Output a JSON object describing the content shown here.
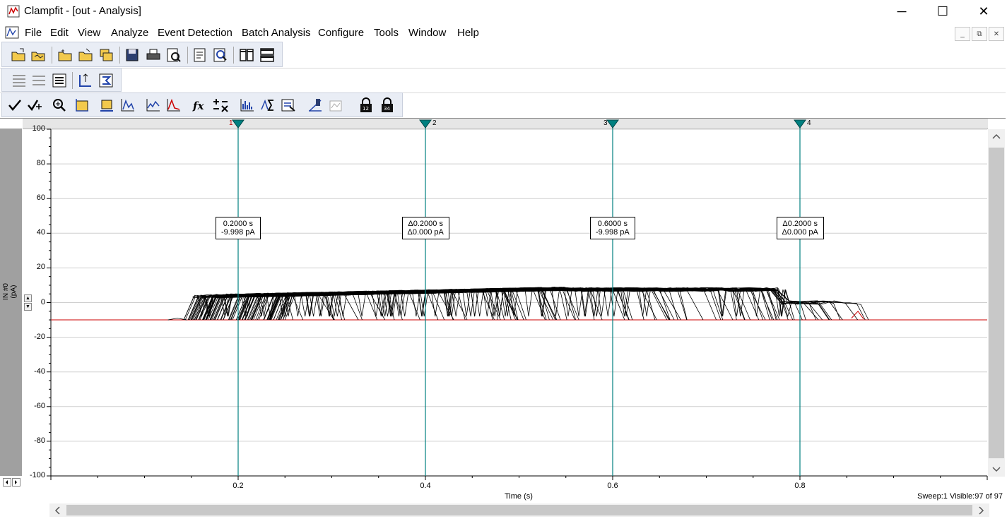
{
  "window": {
    "title": "Clampfit - [out - Analysis]",
    "minimize_glyph": "─",
    "maximize_glyph": "☐",
    "close_glyph": "✕"
  },
  "menu": {
    "items": [
      "File",
      "Edit",
      "View",
      "Analyze",
      "Event Detection",
      "Batch Analysis",
      "Configure",
      "Tools",
      "Window",
      "Help"
    ],
    "mdi_min": "_",
    "mdi_restore": "⧉",
    "mdi_close": "✕"
  },
  "plot": {
    "y_axis_label_line1": "IN #0",
    "y_axis_label_line2": "(pA)",
    "x_axis_label": "Time (s)",
    "y_ticks": [
      "100",
      "80",
      "60",
      "40",
      "20",
      "0",
      "-20",
      "-40",
      "-60",
      "-80",
      "-100"
    ],
    "x_ticks": [
      "0.2",
      "0.4",
      "0.6",
      "0.8"
    ],
    "status": "Sweep:1 Visible:97 of 97"
  },
  "cursors": [
    {
      "num": "1",
      "line1": "0.2000 s",
      "line2": "-9.998 pA"
    },
    {
      "num": "2",
      "line1": "Δ0.2000 s",
      "line2": "Δ0.000 pA"
    },
    {
      "num": "3",
      "line1": "0.6000 s",
      "line2": "-9.998 pA"
    },
    {
      "num": "4",
      "line1": "Δ0.2000 s",
      "line2": "Δ0.000 pA"
    }
  ],
  "chart_data": {
    "type": "line",
    "xlabel": "Time (s)",
    "ylabel": "IN #0 (pA)",
    "xlim": [
      0,
      1.0
    ],
    "ylim": [
      -100,
      100
    ],
    "x_ticks": [
      0.2,
      0.4,
      0.6,
      0.8
    ],
    "y_ticks": [
      100,
      80,
      60,
      40,
      20,
      0,
      -20,
      -40,
      -60,
      -80,
      -100
    ],
    "cursor_times_s": [
      0.2,
      0.4,
      0.6,
      0.8
    ],
    "baseline_pA": -10,
    "sweep_count": 97,
    "series_summary": {
      "open_level_pA_start": 4,
      "open_level_pA_mid": 8,
      "open_level_pA_end": 0,
      "onset_range_s": [
        0.15,
        0.26
      ],
      "offset_range_s": [
        0.25,
        0.87
      ]
    },
    "colors": {
      "trace": "#000000",
      "baseline": "#cc0000",
      "cursor": "#008080"
    }
  }
}
